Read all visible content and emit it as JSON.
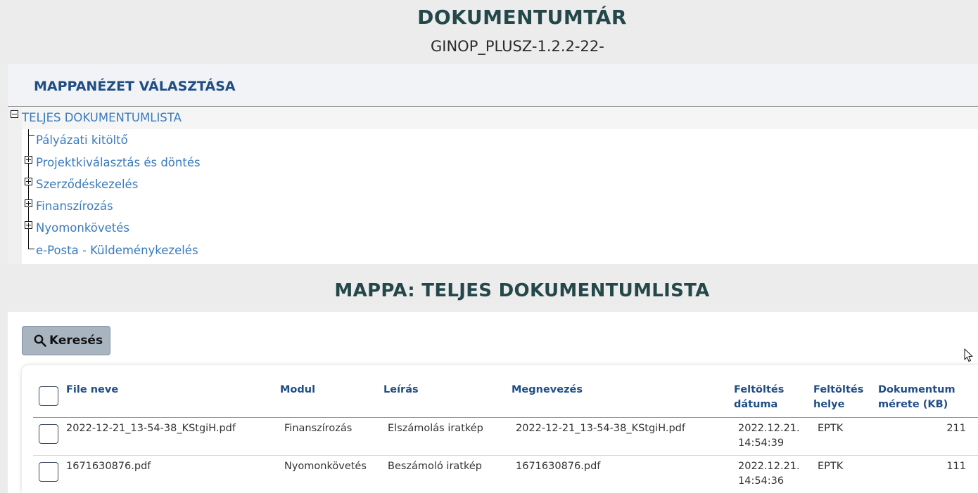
{
  "header": {
    "title": "DOKUMENTUMTÁR",
    "subtitle": "GINOP_PLUSZ-1.2.2-22-"
  },
  "folder_view": {
    "title": "MAPPANÉZET VÁLASZTÁSA",
    "root_label": "TELJES DOKUMENTUMLISTA",
    "items": [
      {
        "label": "Pályázati kitöltő",
        "expandable": false
      },
      {
        "label": "Projektkiválasztás és döntés",
        "expandable": true
      },
      {
        "label": "Szerződéskezelés",
        "expandable": true
      },
      {
        "label": "Finanszírozás",
        "expandable": true
      },
      {
        "label": "Nyomonkövetés",
        "expandable": true
      },
      {
        "label": "e-Posta - Küldeménykezelés",
        "expandable": false
      }
    ]
  },
  "folder_heading": "MAPPA: TELJES DOKUMENTUMLISTA",
  "search": {
    "label": "Keresés",
    "icon": "search-icon"
  },
  "table": {
    "headers": {
      "file_name": "File neve",
      "module": "Modul",
      "description": "Leírás",
      "name": "Megnevezés",
      "upload_date_1": "Feltöltés",
      "upload_date_2": "dátuma",
      "upload_place_1": "Feltöltés",
      "upload_place_2": "helye",
      "size_1": "Dokumentum",
      "size_2": "mérete (KB)"
    },
    "rows": [
      {
        "file_name": "2022-12-21_13-54-38_KStgiH.pdf",
        "module": "Finanszírozás",
        "description": "Elszámolás iratkép",
        "name": "2022-12-21_13-54-38_KStgiH.pdf",
        "date": "2022.12.21.",
        "time": "14:54:39",
        "place": "EPTK",
        "size": "211"
      },
      {
        "file_name": "1671630876.pdf",
        "module": "Nyomonkövetés",
        "description": "Beszámoló iratkép",
        "name": "1671630876.pdf",
        "date": "2022.12.21.",
        "time": "14:54:36",
        "place": "EPTK",
        "size": "111"
      }
    ]
  },
  "colors": {
    "title": "#24474a",
    "accent_blue": "#1f4e86",
    "tree_link": "#3a7bbd",
    "search_button": "#a9b4c1"
  }
}
